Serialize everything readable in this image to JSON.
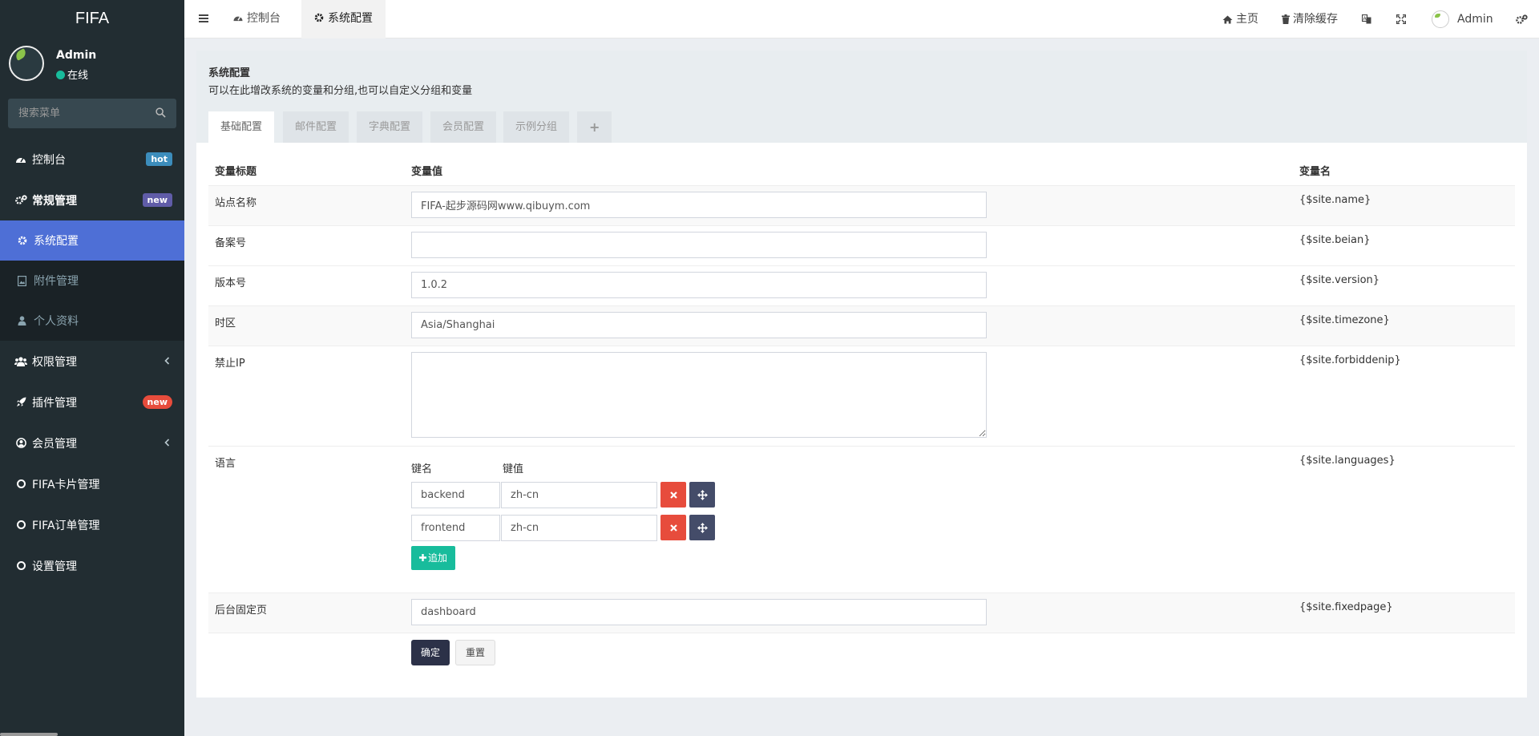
{
  "sidebar": {
    "logo": "FIFA",
    "user": {
      "name": "Admin",
      "status": "在线"
    },
    "search_placeholder": "搜索菜单",
    "menu": [
      {
        "label": "控制台",
        "badge": "hot"
      },
      {
        "label": "常规管理",
        "badge": "new"
      },
      {
        "label": "系统配置"
      },
      {
        "label": "附件管理"
      },
      {
        "label": "个人资料"
      },
      {
        "label": "权限管理"
      },
      {
        "label": "插件管理",
        "badge": "new"
      },
      {
        "label": "会员管理"
      },
      {
        "label": "FIFA卡片管理"
      },
      {
        "label": "FIFA订单管理"
      },
      {
        "label": "设置管理"
      }
    ]
  },
  "header": {
    "tabs": [
      "控制台",
      "系统配置"
    ],
    "home": "主页",
    "clear_cache": "清除缓存",
    "admin": "Admin"
  },
  "panel": {
    "title": "系统配置",
    "description": "可以在此增改系统的变量和分组,也可以自定义分组和变量",
    "tabs": [
      "基础配置",
      "邮件配置",
      "字典配置",
      "会员配置",
      "示例分组",
      "+"
    ]
  },
  "table": {
    "headers": {
      "title": "变量标题",
      "value": "变量值",
      "name": "变量名"
    },
    "rows": [
      {
        "label": "站点名称",
        "value": "FIFA-起步源码网www.qibuym.com",
        "var": "{$site.name}"
      },
      {
        "label": "备案号",
        "value": "",
        "var": "{$site.beian}"
      },
      {
        "label": "版本号",
        "value": "1.0.2",
        "var": "{$site.version}"
      },
      {
        "label": "时区",
        "value": "Asia/Shanghai",
        "var": "{$site.timezone}"
      },
      {
        "label": "禁止IP",
        "value": "",
        "var": "{$site.forbiddenip}"
      },
      {
        "label": "语言",
        "var": "{$site.languages}"
      },
      {
        "label": "后台固定页",
        "value": "dashboard",
        "var": "{$site.fixedpage}"
      }
    ],
    "languages": {
      "key_header": "键名",
      "value_header": "键值",
      "pairs": [
        {
          "key": "backend",
          "value": "zh-cn"
        },
        {
          "key": "frontend",
          "value": "zh-cn"
        }
      ],
      "add_label": "追加"
    },
    "submit_label": "确定",
    "reset_label": "重置"
  },
  "colors": {
    "sidebar": "#222d32",
    "active": "#4e6fd6",
    "accent": "#18bc9c",
    "danger": "#e74c3c"
  }
}
